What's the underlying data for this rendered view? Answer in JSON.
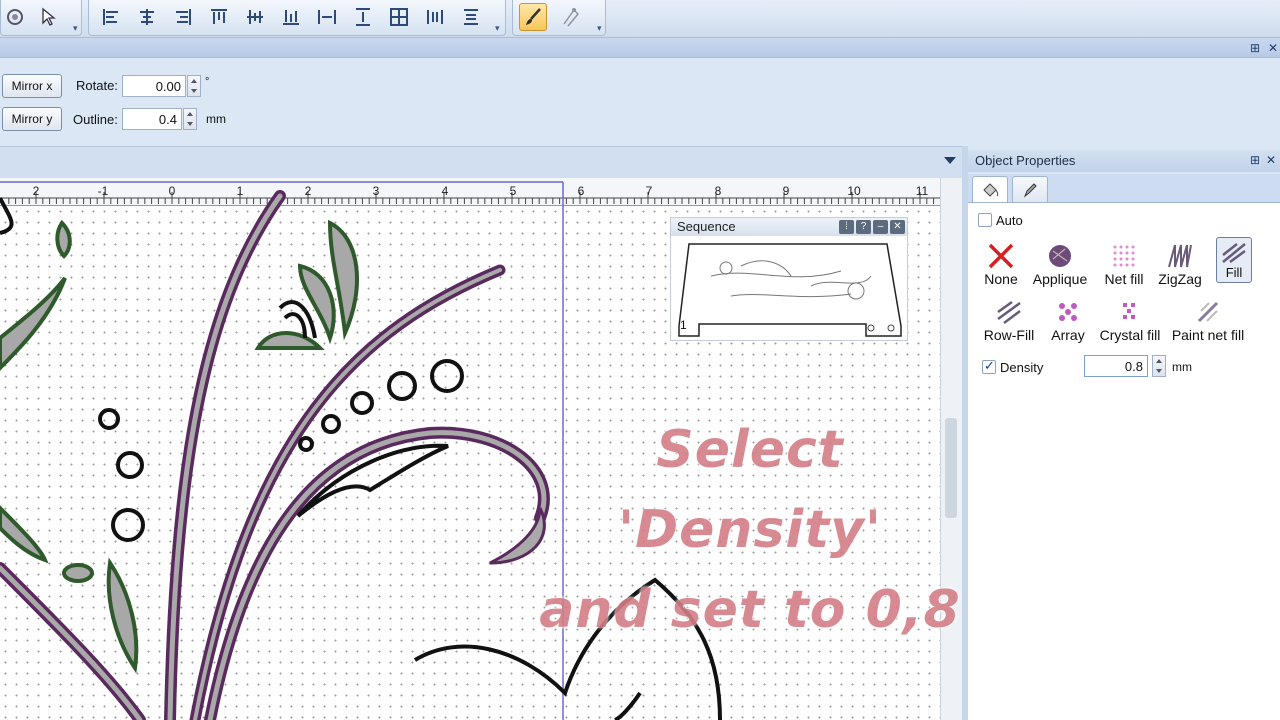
{
  "toolbar": {
    "icons": [
      "tool-icon",
      "select-tool-icon",
      "align-left-icon",
      "align-center-icon",
      "align-right-icon",
      "align-top-icon",
      "align-middle-icon",
      "align-bottom-icon",
      "distribute-horizontal-icon",
      "distribute-vertical-icon",
      "grid-icon",
      "space-horizontal-icon",
      "space-vertical-icon",
      "brush-icon",
      "node-edit-icon"
    ]
  },
  "props": {
    "mirror_x_label": "Mirror x",
    "mirror_y_label": "Mirror y",
    "rotate_label": "Rotate:",
    "rotate_value": "0.00",
    "rotate_unit": "°",
    "outline_label": "Outline:",
    "outline_value": "0.4",
    "outline_unit": "mm"
  },
  "ruler": {
    "labels": [
      "2",
      "-1",
      "0",
      "1",
      "2",
      "3",
      "4",
      "5",
      "6",
      "7",
      "8",
      "9",
      "10",
      "11"
    ]
  },
  "sequence": {
    "title": "Sequence",
    "item_number": "1"
  },
  "overlay": {
    "line1": "Select 'Density'",
    "line2": "and set to 0,8"
  },
  "object_properties": {
    "title": "Object Properties",
    "auto_label": "Auto",
    "fill_options": [
      "None",
      "Applique",
      "Net fill",
      "ZigZag",
      "Fill",
      "Row-Fill",
      "Array",
      "Crystal fill",
      "Paint net fill"
    ],
    "selected_fill": "Fill",
    "density_label": "Density",
    "density_value": "0.8",
    "density_unit": "mm"
  },
  "colors": {
    "purple_stitch": "#5a2a5e",
    "green_stitch": "#2e5a2c",
    "overlay_text": "#d37e86"
  }
}
